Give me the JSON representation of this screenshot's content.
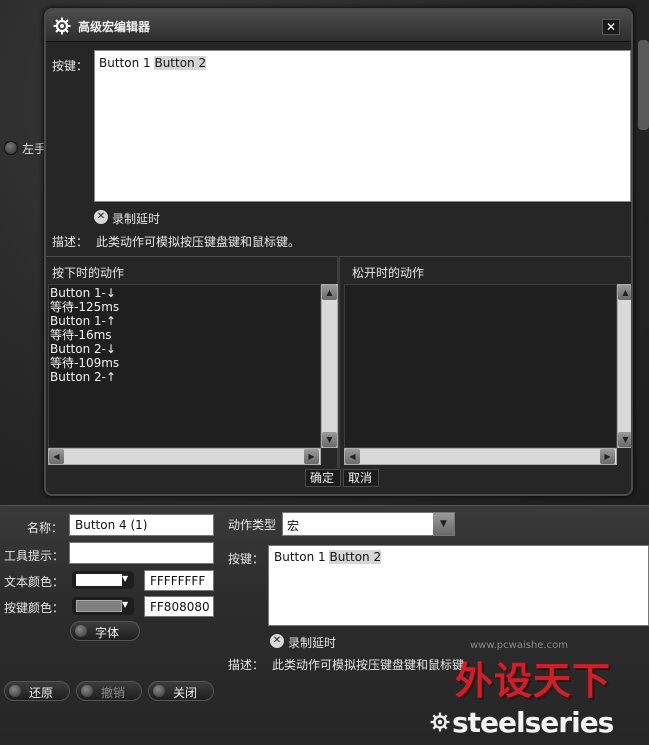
{
  "background": {
    "left_option_label": "左手"
  },
  "dialog": {
    "title": "高级宏编辑器",
    "close_glyph": "✕",
    "key_label": "按键：",
    "key_value_part1": "Button 1 ",
    "key_value_part2": "Button 2",
    "record_delay_label": "录制延时",
    "description_label": "描述：",
    "description_text": "此类动作可模拟按压键盘键和鼠标键。",
    "press_header": "按下时的动作",
    "release_header": "松开时的动作",
    "press_actions": [
      "Button 1-↓",
      "等待-125ms",
      "Button 1-↑",
      "等待-16ms",
      "Button 2-↓",
      "等待-109ms",
      "Button 2-↑"
    ],
    "ok_label": "确定",
    "cancel_label": "取消"
  },
  "form": {
    "name_label": "名称：",
    "name_value": "Button 4 (1)",
    "tooltip_label": "工具提示：",
    "tooltip_value": "",
    "text_color_label": "文本颜色：",
    "text_color_hex": "FFFFFFFF",
    "button_color_label": "按键颜色：",
    "button_color_hex": "FF808080",
    "font_button": "字体",
    "action_type_label": "动作类型",
    "action_type_value": "宏",
    "key_label": "按键：",
    "key_value_part1": "Button 1 ",
    "key_value_part2": "Button 2",
    "record_delay_label": "录制延时",
    "description_label": "描述：",
    "description_text": "此类动作可模拟按压键盘键和鼠标键。"
  },
  "footer": {
    "restore_label": "还原",
    "undo_label": "撤销",
    "close_label": "关闭",
    "brand": "steelseries",
    "watermark": "外设天下",
    "watermark_url": "www.pcwaishe.com"
  },
  "colors": {
    "text_color": "#ffffff",
    "button_color": "#808080",
    "watermark_red": "#cf1f2a"
  }
}
